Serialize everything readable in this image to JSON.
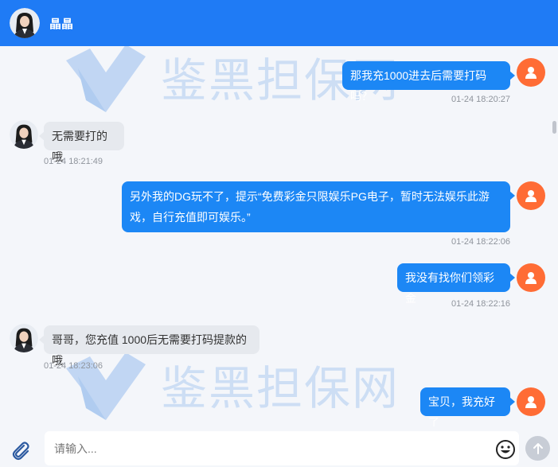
{
  "header": {
    "contact_name": "晶晶",
    "color": "#1f7bf5"
  },
  "watermark": {
    "text": "鉴黑担保网"
  },
  "messages": [
    {
      "side": "out",
      "text": "那我充1000进去后需要打码吗？",
      "time": "01-24 18:20:27"
    },
    {
      "side": "in",
      "text": "无需要打的哦",
      "time": "01-24 18:21:49"
    },
    {
      "side": "out",
      "text": "另外我的DG玩不了，提示“免费彩金只限娱乐PG电子，暂时无法娱乐此游戏，自行充值即可娱乐。”",
      "time": "01-24 18:22:06"
    },
    {
      "side": "out",
      "text": "我没有找你们领彩金",
      "time": "01-24 18:22:16"
    },
    {
      "side": "in",
      "text": "哥哥，您充值 1000后无需要打码提款的哦",
      "time": "01-24 18:23:06"
    },
    {
      "side": "out",
      "text": "宝贝，我充好了",
      "time": ""
    }
  ],
  "composer": {
    "placeholder": "请输入...",
    "value": ""
  },
  "icons": {
    "attach": "paperclip-icon",
    "emoji": "smiley-icon",
    "send": "arrow-up-icon",
    "user": "user-icon"
  },
  "colors": {
    "outgoing_bubble": "#1c87f5",
    "incoming_bubble": "#e6e9ee",
    "user_avatar": "#ff6c35"
  }
}
